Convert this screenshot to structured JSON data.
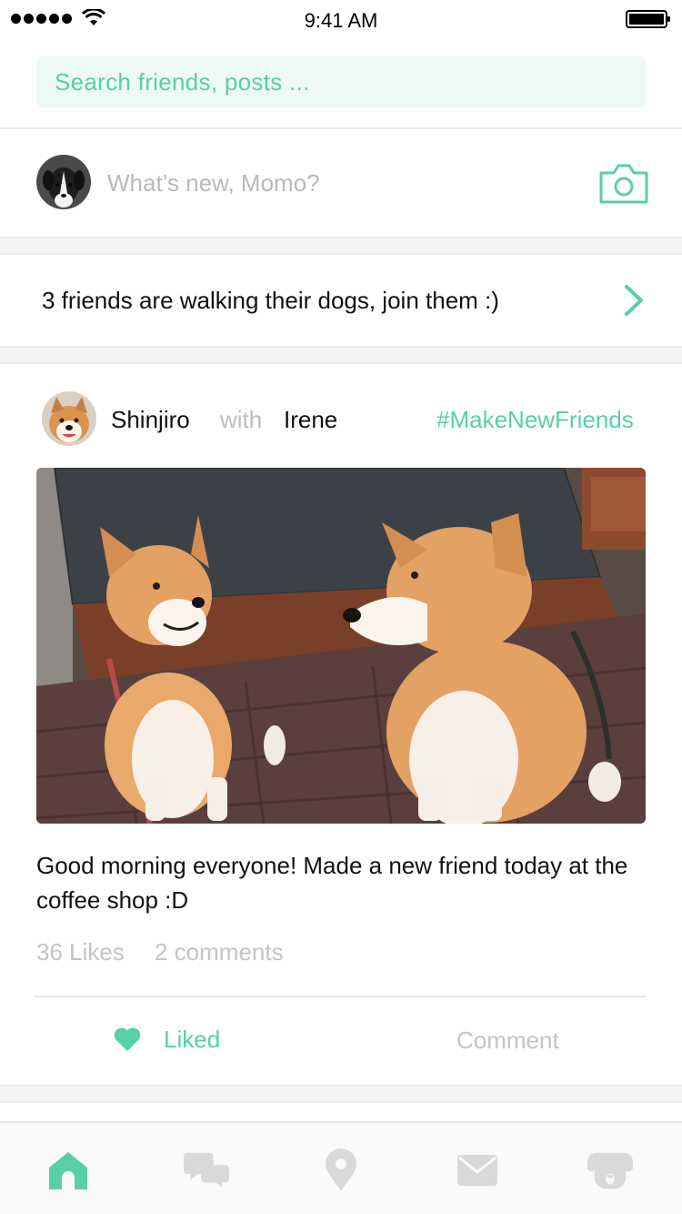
{
  "status_bar": {
    "time": "9:41 AM"
  },
  "search": {
    "placeholder": "Search friends, posts ..."
  },
  "composer": {
    "placeholder": "What’s new, Momo?"
  },
  "walking_banner": {
    "text": "3 friends are walking their dogs, join them :)"
  },
  "post": {
    "author": "Shinjiro",
    "with_label": "with",
    "tagged_friend": "Irene",
    "hashtag": "#MakeNewFriends",
    "caption": "Good morning everyone! Made a new friend today at the coffee shop :D",
    "likes": "36 Likes",
    "comments": "2 comments",
    "like_label": "Liked",
    "comment_label": "Comment"
  },
  "tabbar": {
    "items": [
      {
        "icon": "home-icon",
        "active": true
      },
      {
        "icon": "chat-icon",
        "active": false
      },
      {
        "icon": "location-pin-icon",
        "active": false
      },
      {
        "icon": "mail-icon",
        "active": false
      },
      {
        "icon": "dog-profile-icon",
        "active": false
      }
    ]
  },
  "colors": {
    "accent": "#59cfa6",
    "muted": "#c4c4c4",
    "inactive_icon": "#d9d9d9"
  }
}
